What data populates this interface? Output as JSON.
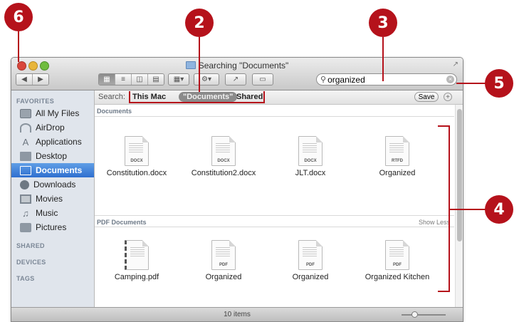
{
  "window": {
    "title": "Searching \"Documents\""
  },
  "toolbar": {
    "back_icon": "back-arrow-icon",
    "forward_icon": "forward-arrow-icon",
    "view_buttons": [
      "icon-view-icon",
      "list-view-icon",
      "column-view-icon",
      "cover-flow-icon"
    ],
    "arrange_icon": "arrange-icon",
    "action_icon": "gear-icon",
    "share_icon": "share-icon",
    "tags_icon": "tag-icon"
  },
  "search": {
    "value": "organized",
    "search_icon": "magnifier-icon",
    "clear_icon": "clear-icon"
  },
  "search_scope": {
    "label": "Search:",
    "options": [
      "This Mac",
      "\"Documents\"",
      "Shared"
    ],
    "selected": "\"Documents\"",
    "save_label": "Save",
    "add_label": "+"
  },
  "sidebar": {
    "favorites_header": "FAVORITES",
    "items": [
      {
        "label": "All My Files",
        "icon": "all-files-icon"
      },
      {
        "label": "AirDrop",
        "icon": "airdrop-icon"
      },
      {
        "label": "Applications",
        "icon": "applications-icon"
      },
      {
        "label": "Desktop",
        "icon": "desktop-icon"
      },
      {
        "label": "Documents",
        "icon": "documents-icon",
        "selected": true
      },
      {
        "label": "Downloads",
        "icon": "downloads-icon"
      },
      {
        "label": "Movies",
        "icon": "movies-icon"
      },
      {
        "label": "Music",
        "icon": "music-icon"
      },
      {
        "label": "Pictures",
        "icon": "pictures-icon"
      }
    ],
    "shared_header": "SHARED",
    "devices_header": "DEVICES",
    "tags_header": "TAGS"
  },
  "sections": [
    {
      "title": "Documents",
      "files": [
        {
          "name": "Constitution.docx",
          "ext": "DOCX"
        },
        {
          "name": "Constitution2.docx",
          "ext": "DOCX"
        },
        {
          "name": "JLT.docx",
          "ext": "DOCX"
        },
        {
          "name": "Organized",
          "ext": "RTFD"
        }
      ]
    },
    {
      "title": "PDF Documents",
      "toggle": "Show Less",
      "files": [
        {
          "name": "Camping.pdf",
          "ext": ""
        },
        {
          "name": "Organized",
          "ext": "PDF"
        },
        {
          "name": "Organized",
          "ext": "PDF"
        },
        {
          "name": "Organized Kitchen",
          "ext": "PDF"
        }
      ]
    }
  ],
  "status": {
    "item_count": "10 items"
  },
  "callouts": [
    "6",
    "2",
    "3",
    "5",
    "4"
  ],
  "colors": {
    "callout": "#b5121b",
    "selection": "#2f6fcf",
    "sidebar_bg": "#e0e5ec"
  }
}
